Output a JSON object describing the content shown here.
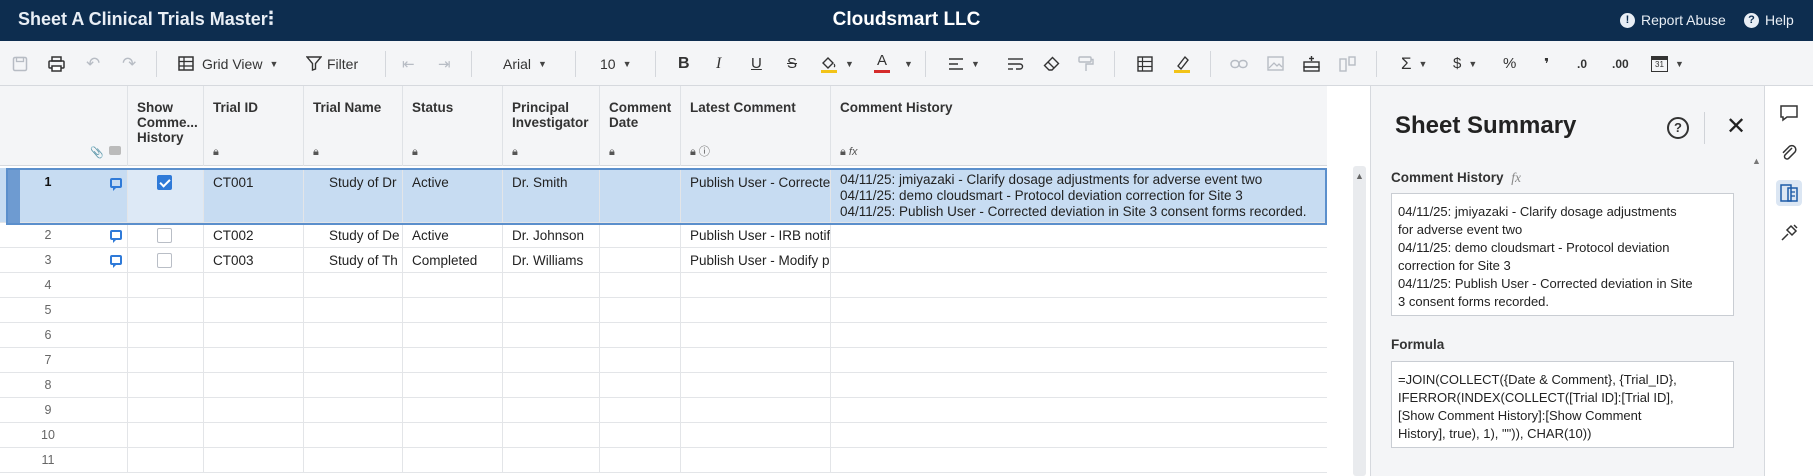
{
  "app": {
    "sheet_title": "Sheet A Clinical Trials Master",
    "title_menu_glyph": "⋮",
    "company": "Cloudsmart LLC",
    "report_abuse": "Report Abuse",
    "help": "Help"
  },
  "toolbar": {
    "grid_view": "Grid View",
    "filter": "Filter",
    "font": "Arial",
    "font_size": "10",
    "bold": "B",
    "italic": "I",
    "underline": "U",
    "strike": "S",
    "text_color": "A",
    "sum": "Σ",
    "currency": "$",
    "percent": "%",
    "thousands": "❜",
    "dec_decrease": ".0",
    "dec_increase": ".00",
    "date_num": "31"
  },
  "grid": {
    "columns": [
      {
        "label": "Show Comme... History"
      },
      {
        "label": "Trial ID"
      },
      {
        "label": "Trial Name"
      },
      {
        "label": "Status"
      },
      {
        "label": "Principal Investigator"
      },
      {
        "label": "Comment Date"
      },
      {
        "label": "Latest Comment"
      },
      {
        "label": "Comment History"
      }
    ],
    "rows": [
      {
        "num": "1",
        "trial_id": "CT001",
        "trial_name": "Study of Dr",
        "status": "Active",
        "pi": "Dr. Smith",
        "comment_date": "",
        "latest": "Publish User - Correcte",
        "history": [
          "04/11/25: jmiyazaki - Clarify dosage adjustments for adverse event two",
          "04/11/25: demo cloudsmart - Protocol deviation correction for Site 3",
          "04/11/25: Publish User - Corrected deviation in Site 3 consent forms recorded."
        ]
      },
      {
        "num": "2",
        "trial_id": "CT002",
        "trial_name": "Study of De",
        "status": "Active",
        "pi": "Dr. Johnson",
        "comment_date": "",
        "latest": "Publish User - IRB notif"
      },
      {
        "num": "3",
        "trial_id": "CT003",
        "trial_name": "Study of Th",
        "status": "Completed",
        "pi": "Dr. Williams",
        "comment_date": "",
        "latest": "Publish User - Modify p"
      }
    ],
    "empty_rows": [
      "4",
      "5",
      "6",
      "7",
      "8",
      "9",
      "10",
      "11"
    ]
  },
  "panel": {
    "title": "Sheet Summary",
    "help_glyph": "?",
    "close_glyph": "✕",
    "field_label": "Comment History",
    "fx_glyph": "fx",
    "value_lines": [
      "04/11/25: jmiyazaki - Clarify dosage adjustments",
      "for adverse event two",
      "04/11/25: demo cloudsmart - Protocol deviation",
      "correction for Site 3",
      "04/11/25: Publish User - Corrected deviation in Site",
      "3 consent forms recorded."
    ],
    "formula_label": "Formula",
    "formula_lines": [
      "=JOIN(COLLECT({Date & Comment}, {Trial_ID},",
      "IFERROR(INDEX(COLLECT([Trial ID]:[Trial ID],",
      "[Show Comment History]:[Show Comment",
      "History], true), 1), \"\")), CHAR(10))"
    ]
  },
  "colors": {
    "topbar": "#0d2d4f",
    "selection": "#c7dcf2",
    "accent": "#2f7ad8"
  }
}
